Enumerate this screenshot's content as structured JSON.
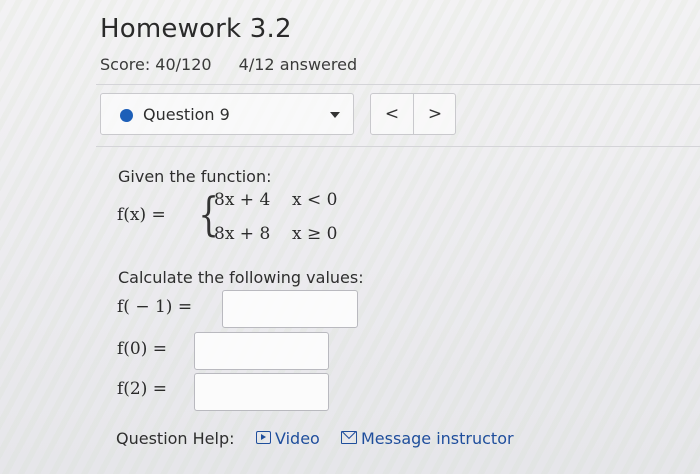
{
  "header": {
    "title": "Homework 3.2",
    "score": "Score: 40/120",
    "answered": "4/12 answered"
  },
  "question_nav": {
    "selected": "Question 9",
    "prev_label": "<",
    "next_label": ">"
  },
  "problem": {
    "intro": "Given the function:",
    "function_lhs": "f(x) =",
    "cases": [
      {
        "expr": "8x + 4",
        "cond": "x < 0"
      },
      {
        "expr": "8x + 8",
        "cond": "x ≥ 0"
      }
    ],
    "instruction": "Calculate the following values:",
    "items": [
      {
        "label": "f( − 1) =",
        "value": ""
      },
      {
        "label": "f(0) =",
        "value": ""
      },
      {
        "label": "f(2) =",
        "value": ""
      }
    ]
  },
  "help": {
    "label": "Question Help:",
    "video": "Video",
    "message": "Message instructor"
  },
  "colors": {
    "accent": "#1d5fb8",
    "link": "#1f4e9c"
  }
}
